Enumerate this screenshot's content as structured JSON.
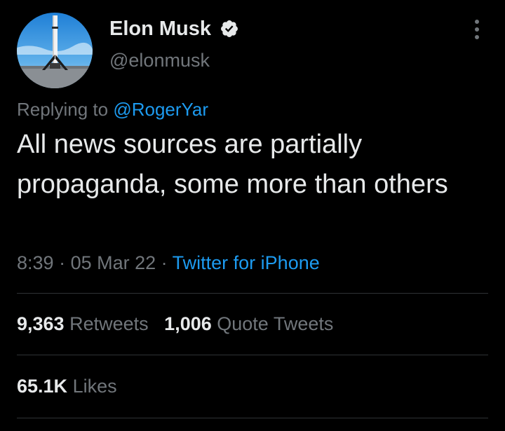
{
  "author": {
    "display_name": "Elon Musk",
    "handle": "@elonmusk",
    "verified": true,
    "avatar_icon": "rocket-booster-avatar"
  },
  "reply": {
    "prefix": "Replying to ",
    "to_handle": "@RogerYar"
  },
  "tweet": {
    "text": "All news sources are partially propaganda, some more than others"
  },
  "meta": {
    "time": "8:39",
    "separator": " · ",
    "date": "05 Mar 22",
    "source": "Twitter for iPhone"
  },
  "stats": {
    "retweets_count": "9,363",
    "retweets_label": "Retweets",
    "quotes_count": "1,006",
    "quotes_label": "Quote Tweets",
    "likes_count": "65.1K",
    "likes_label": "Likes"
  },
  "colors": {
    "background": "#000000",
    "text": "#e7e9ea",
    "secondary": "#71767b",
    "accent": "#1d9bf0",
    "divider": "#2f3336"
  }
}
